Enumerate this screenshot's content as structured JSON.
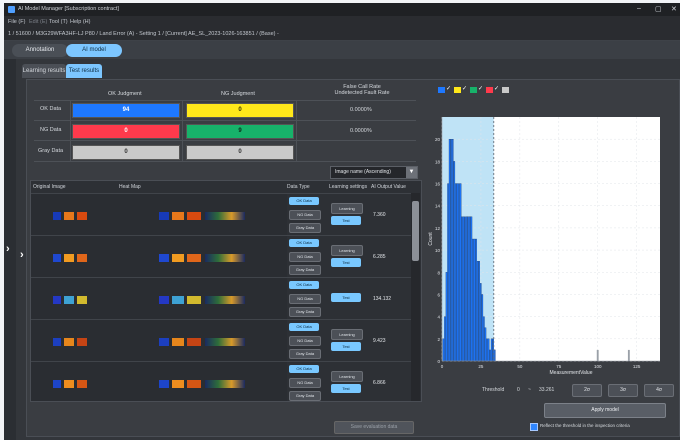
{
  "titlebar": {
    "title": "AI Model Manager [Subscription contract]",
    "minimize": "–",
    "maximize": "▢",
    "close": "✕"
  },
  "menu": {
    "items": [
      "File (F)",
      "Edit (E)",
      "Tool (T)",
      "Help (H)"
    ]
  },
  "path": "1 / 51600 / M3G29WFA3HF-LJ P80 / Land Error (A) - Setting 1 / [Current] AE_SL_2023-1026-163851 / (Base) -",
  "topnav": {
    "annotation": "Annotation",
    "ai_model": "AI model"
  },
  "subtabs": {
    "learning": "Learning results",
    "test": "Test results"
  },
  "judgment": {
    "ok_header": "OK Judgment",
    "ng_header": "NG Judgment",
    "rate_header": "False Call Rate\nUndetected Fault Rate",
    "ok_row": "OK Data",
    "ng_row": "NG Data",
    "gray_row": "Gray Data",
    "ok_ok": "94",
    "ok_ng": "0",
    "ok_rate": "0.0000%",
    "ng_ok": "0",
    "ng_ng": "9",
    "ng_rate": "0.0000%",
    "gray_ok": "0",
    "gray_ng": "0",
    "colors": {
      "ok": "#1e78ff",
      "ng_yellow": "#ffe81a",
      "ng_red": "#ff3a4c",
      "ng_green": "#17b26a",
      "gray": "#c9c9c9"
    }
  },
  "sort": {
    "label": "Image name (Ascending)"
  },
  "list": {
    "headers": {
      "original": "Original Image",
      "heatmap": "Heat Map",
      "datatype": "Data Type",
      "learning": "Learning settings",
      "output": "AI Output Value"
    },
    "datatype_labels": {
      "ok": "OK Data",
      "ng": "NG Data",
      "gray": "Gray Data"
    },
    "learning_label": "Learning",
    "test_label": "Test",
    "rows": [
      {
        "output": "7.360"
      },
      {
        "output": "6.285"
      },
      {
        "output": "134.132"
      },
      {
        "output": "9.423"
      },
      {
        "output": "6.866"
      }
    ]
  },
  "chart_data": {
    "type": "bar",
    "xlabel": "MeasurementValue",
    "ylabel": "Count",
    "xticks": [
      "0",
      "25",
      "50",
      "75",
      "100",
      "125"
    ],
    "yticks": [
      "0",
      "2",
      "4",
      "6",
      "8",
      "10",
      "12",
      "14",
      "16",
      "18",
      "20"
    ],
    "ylim": [
      0,
      22
    ],
    "xlim": [
      0,
      140
    ],
    "threshold": 33.261,
    "ok_bins": [
      {
        "x": 1,
        "count": 2
      },
      {
        "x": 2,
        "count": 4
      },
      {
        "x": 3,
        "count": 8
      },
      {
        "x": 4,
        "count": 16
      },
      {
        "x": 5,
        "count": 20
      },
      {
        "x": 6,
        "count": 20
      },
      {
        "x": 7,
        "count": 20
      },
      {
        "x": 8,
        "count": 18
      },
      {
        "x": 9,
        "count": 16
      },
      {
        "x": 10,
        "count": 16
      },
      {
        "x": 11,
        "count": 16
      },
      {
        "x": 12,
        "count": 16
      },
      {
        "x": 13,
        "count": 13
      },
      {
        "x": 14,
        "count": 13
      },
      {
        "x": 15,
        "count": 13
      },
      {
        "x": 16,
        "count": 13
      },
      {
        "x": 17,
        "count": 13
      },
      {
        "x": 18,
        "count": 13
      },
      {
        "x": 19,
        "count": 13
      },
      {
        "x": 20,
        "count": 11
      },
      {
        "x": 21,
        "count": 11
      },
      {
        "x": 22,
        "count": 11
      },
      {
        "x": 23,
        "count": 9
      },
      {
        "x": 24,
        "count": 9
      },
      {
        "x": 25,
        "count": 7
      },
      {
        "x": 26,
        "count": 6
      },
      {
        "x": 27,
        "count": 4
      },
      {
        "x": 28,
        "count": 3
      },
      {
        "x": 29,
        "count": 2
      },
      {
        "x": 30,
        "count": 2
      },
      {
        "x": 31,
        "count": 1
      },
      {
        "x": 32,
        "count": 2
      },
      {
        "x": 33,
        "count": 2
      },
      {
        "x": 34,
        "count": 1
      }
    ],
    "ng_bins": [
      {
        "x": 100,
        "count": 1
      },
      {
        "x": 120,
        "count": 1
      }
    ],
    "legend_colors": [
      "#1e78ff",
      "#ffe81a",
      "#17b26a",
      "#ff3a4c",
      "#c9c9c9"
    ]
  },
  "threshold": {
    "label": "Threshold",
    "value": "0",
    "dash": "~",
    "max": "33.261",
    "btn2": "2σ",
    "btn3": "3σ",
    "btn4": "4σ"
  },
  "bottom": {
    "save_label": "Save evaluation data",
    "apply_label": "Apply model",
    "reflect_label": "Reflect the threshold in the inspection criteria"
  }
}
